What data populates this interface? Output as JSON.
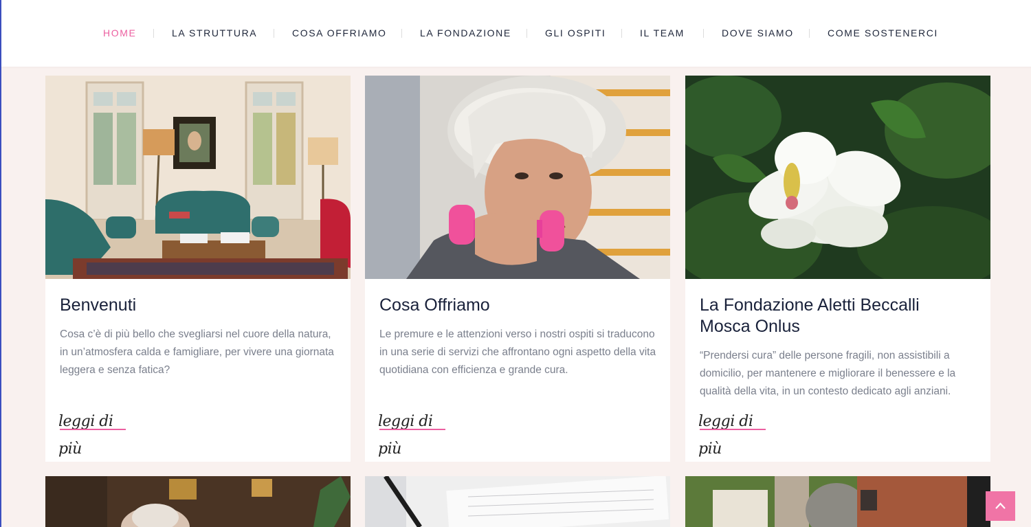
{
  "nav": {
    "items": [
      {
        "label": "HOME",
        "active": true
      },
      {
        "label": "LA STRUTTURA",
        "active": false
      },
      {
        "label": "COSA OFFRIAMO",
        "active": false
      },
      {
        "label": "LA FONDAZIONE",
        "active": false
      },
      {
        "label": "GLI OSPITI",
        "active": false
      },
      {
        "label": "IL TEAM",
        "active": false
      },
      {
        "label": "DOVE SIAMO",
        "active": false
      },
      {
        "label": "COME SOSTENERCI",
        "active": false
      }
    ]
  },
  "cards": [
    {
      "title": "Benvenuti",
      "text": "Cosa c’è di più bello che svegliarsi nel cuore della natura, in un’atmosfera calda e famigliare, per vivere una giornata leggera e senza fatica?",
      "link": "leggi di più"
    },
    {
      "title": "Cosa Offriamo",
      "text": "Le premure e le attenzioni verso i nostri ospiti si traducono in una serie di servizi che affrontano ogni aspetto della vita quotidiana con efficienza e grande cura.",
      "link": "leggi di più"
    },
    {
      "title": "La Fondazione Aletti Beccalli Mosca Onlus",
      "text": "“Prendersi cura” delle persone fragili, non assistibili a domicilio, per mantenere e migliorare il benessere e la qualità della vita, in un contesto dedicato agli anziani.",
      "link": "leggi di più"
    }
  ],
  "colors": {
    "accent": "#ec5fa0",
    "heading": "#19213a",
    "body_text": "#7a7f8c",
    "page_bg": "#f9f1ef"
  },
  "icons": {
    "scroll_top": "chevron-up-icon"
  }
}
